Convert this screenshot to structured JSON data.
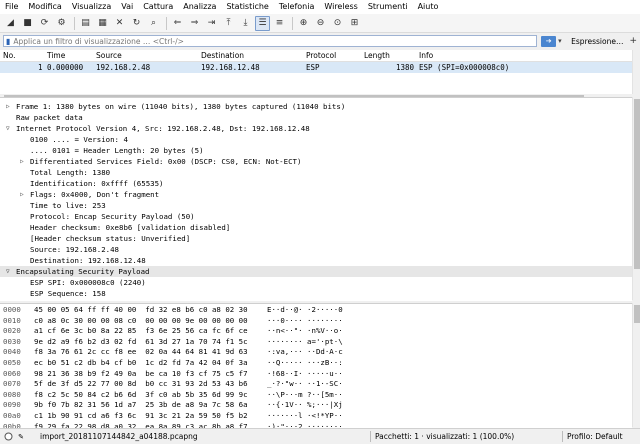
{
  "menu": [
    "File",
    "Modifica",
    "Visualizza",
    "Vai",
    "Cattura",
    "Analizza",
    "Statistiche",
    "Telefonia",
    "Wireless",
    "Strumenti",
    "Aiuto"
  ],
  "toolbar_icons": [
    "shark-fin-icon",
    "stop-icon",
    "restart-icon",
    "options-gear-icon",
    "open-folder-icon",
    "save-icon",
    "close-file-icon",
    "reload-icon",
    "find-icon",
    "back-arrow-icon",
    "forward-arrow-icon",
    "goto-packet-icon",
    "first-packet-icon",
    "last-packet-icon",
    "autoscroll-icon",
    "colorize-icon",
    "zoom-in-icon",
    "zoom-out-icon",
    "normal-size-icon",
    "resize-columns-icon"
  ],
  "filter": {
    "placeholder": "Applica un filtro di visualizzazione … <Ctrl-/>",
    "expression_label": "Espressione…",
    "plus": "+"
  },
  "packet_list": {
    "headers": {
      "no": "No.",
      "time": "Time",
      "source": "Source",
      "destination": "Destination",
      "protocol": "Protocol",
      "length": "Length",
      "info": "Info"
    },
    "rows": [
      {
        "no": "1",
        "time": "0.000000",
        "source": "192.168.2.48",
        "destination": "192.168.12.48",
        "protocol": "ESP",
        "length": "1380",
        "info": "ESP (SPI=0x000008c0)"
      }
    ]
  },
  "details": [
    {
      "text": "Frame 1: 1380 bytes on wire (11040 bits), 1380 bytes captured (11040 bits)",
      "indent": 0,
      "tri": "closed"
    },
    {
      "text": "Raw packet data",
      "indent": 0,
      "tri": "none"
    },
    {
      "text": "Internet Protocol Version 4, Src: 192.168.2.48, Dst: 192.168.12.48",
      "indent": 0,
      "tri": "open"
    },
    {
      "text": "0100 .... = Version: 4",
      "indent": 1,
      "tri": "none"
    },
    {
      "text": ".... 0101 = Header Length: 20 bytes (5)",
      "indent": 1,
      "tri": "none"
    },
    {
      "text": "Differentiated Services Field: 0x00 (DSCP: CS0, ECN: Not-ECT)",
      "indent": 1,
      "tri": "closed"
    },
    {
      "text": "Total Length: 1380",
      "indent": 1,
      "tri": "none"
    },
    {
      "text": "Identification: 0xffff (65535)",
      "indent": 1,
      "tri": "none"
    },
    {
      "text": "Flags: 0x4000, Don't fragment",
      "indent": 1,
      "tri": "closed"
    },
    {
      "text": "Time to live: 253",
      "indent": 1,
      "tri": "none"
    },
    {
      "text": "Protocol: Encap Security Payload (50)",
      "indent": 1,
      "tri": "none"
    },
    {
      "text": "Header checksum: 0xe8b6 [validation disabled]",
      "indent": 1,
      "tri": "none"
    },
    {
      "text": "[Header checksum status: Unverified]",
      "indent": 1,
      "tri": "none"
    },
    {
      "text": "Source: 192.168.2.48",
      "indent": 1,
      "tri": "none"
    },
    {
      "text": "Destination: 192.168.12.48",
      "indent": 1,
      "tri": "none"
    },
    {
      "text": "Encapsulating Security Payload",
      "indent": 0,
      "tri": "open",
      "selected": true
    },
    {
      "text": "ESP SPI: 0x000008c0 (2240)",
      "indent": 1,
      "tri": "none"
    },
    {
      "text": "ESP Sequence: 158",
      "indent": 1,
      "tri": "none"
    }
  ],
  "bytes": [
    {
      "off": "0000",
      "hex": "45 00 05 64 ff ff 40 00  fd 32 e8 b6 c0 a8 02 30",
      "ascii": "E··d··@· ·2·····0"
    },
    {
      "off": "0010",
      "hex": "c0 a8 0c 30 00 00 08 c0  00 00 00 9e 00 00 00 00",
      "ascii": "···0···· ········"
    },
    {
      "off": "0020",
      "hex": "a1 cf 6e 3c b0 8a 22 85  f3 6e 25 56 ca fc 6f ce",
      "ascii": "··n<··\"· ·n%V··o·"
    },
    {
      "off": "0030",
      "hex": "9e d2 a9 f6 b2 d3 02 fd  61 3d 27 1a 70 74 f1 5c",
      "ascii": "········ a='·pt·\\"
    },
    {
      "off": "0040",
      "hex": "f8 3a 76 61 2c cc f8 ee  02 0a 44 64 81 41 9d 63",
      "ascii": "·:va,··· ··Dd·A·c"
    },
    {
      "off": "0050",
      "hex": "ec b0 51 c2 db b4 cf b0  1c d2 fd 7a 42 04 0f 3a",
      "ascii": "··Q····· ···zB··:"
    },
    {
      "off": "0060",
      "hex": "98 21 36 38 b9 f2 49 0a  be ca 10 f3 cf 75 c5 f7",
      "ascii": "·!68··I· ·····u··"
    },
    {
      "off": "0070",
      "hex": "5f de 3f d5 22 77 00 8d  b0 cc 31 93 2d 53 43 b6",
      "ascii": "_·?·\"w·· ··1·-SC·"
    },
    {
      "off": "0080",
      "hex": "f8 c2 5c 50 84 c2 b6 6d  3f c0 ab 5b 35 6d 99 9c",
      "ascii": "··\\P···m ?··[5m··"
    },
    {
      "off": "0090",
      "hex": "9b f0 7b 82 31 56 1d a7  25 3b de a8 9a 7c 58 6a",
      "ascii": "··{·1V·· %;···|Xj"
    },
    {
      "off": "00a0",
      "hex": "c1 1b 90 91 cd a6 f3 6c  91 3c 21 2a 59 50 f5 b2",
      "ascii": "·······l ·<!*YP··"
    },
    {
      "off": "00b0",
      "hex": "f9 29 fa 22 98 d8 a0 32  ea 8a 89 c3 ac 8b a8 f7",
      "ascii": "·)·\"···2 ········"
    }
  ],
  "status": {
    "file": "import_20181107144842_a04188.pcapng",
    "packets": "Pacchetti: 1 · visualizzati: 1 (100.0%)",
    "profile": "Profilo: Default"
  }
}
